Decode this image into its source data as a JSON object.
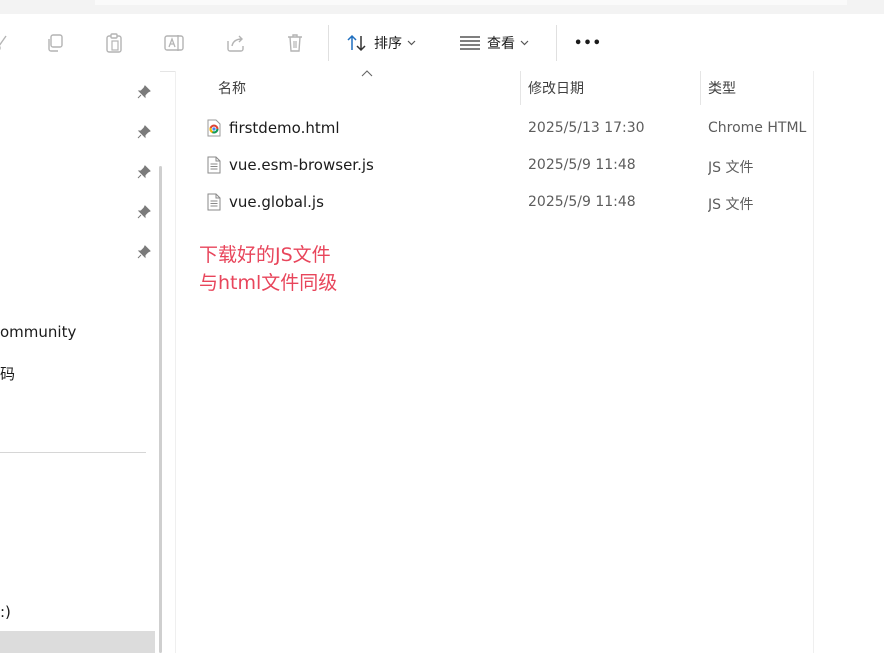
{
  "toolbar": {
    "sort_label": "排序",
    "view_label": "查看",
    "more_label": "•••"
  },
  "sidebar": {
    "items": [
      {
        "label": "ommunity"
      },
      {
        "label": "码"
      },
      {
        "label": ":)"
      }
    ]
  },
  "columns": {
    "name": "名称",
    "date": "修改日期",
    "type": "类型"
  },
  "files": [
    {
      "name": "firstdemo.html",
      "date": "2025/5/13 17:30",
      "type": "Chrome HTML",
      "icon": "chrome-html-icon"
    },
    {
      "name": "vue.esm-browser.js",
      "date": "2025/5/9 11:48",
      "type": "JS 文件",
      "icon": "js-file-icon"
    },
    {
      "name": "vue.global.js",
      "date": "2025/5/9 11:48",
      "type": "JS 文件",
      "icon": "js-file-icon"
    }
  ],
  "annotation": {
    "line1": "下载好的JS文件",
    "line2": "与html文件同级"
  }
}
